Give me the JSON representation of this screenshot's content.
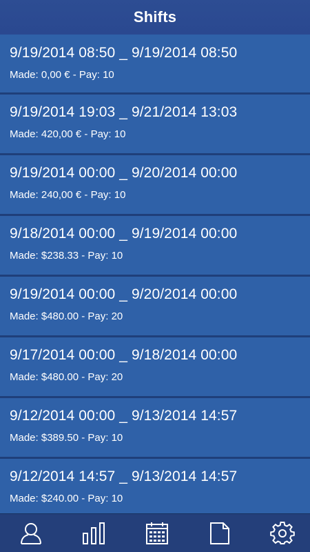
{
  "header": {
    "title": "Shifts"
  },
  "shifts": [
    {
      "range": "9/19/2014 08:50 _ 9/19/2014 08:50",
      "info": "Made: 0,00 € - Pay: 10"
    },
    {
      "range": "9/19/2014 19:03 _ 9/21/2014 13:03",
      "info": "Made: 420,00 € - Pay: 10"
    },
    {
      "range": "9/19/2014 00:00 _ 9/20/2014 00:00",
      "info": "Made: 240,00 € - Pay: 10"
    },
    {
      "range": "9/18/2014 00:00 _ 9/19/2014 00:00",
      "info": "Made: $238.33 - Pay: 10"
    },
    {
      "range": "9/19/2014 00:00 _ 9/20/2014 00:00",
      "info": "Made: $480.00 - Pay: 20"
    },
    {
      "range": "9/17/2014 00:00 _ 9/18/2014 00:00",
      "info": "Made: $480.00 - Pay: 20"
    },
    {
      "range": "9/12/2014 00:00 _ 9/13/2014 14:57",
      "info": "Made: $389.50 - Pay: 10"
    },
    {
      "range": "9/12/2014 14:57 _ 9/13/2014 14:57",
      "info": "Made: $240.00 - Pay: 10"
    }
  ],
  "tabbar": {
    "icons": [
      "user-icon",
      "bar-chart-icon",
      "calendar-icon",
      "document-icon",
      "gear-icon"
    ]
  },
  "colors": {
    "header_bg": "#2b4a91",
    "row_bg": "#2f61a8",
    "separator": "#1f3f7a",
    "tabbar_bg": "#243f7a",
    "text": "#ffffff"
  }
}
